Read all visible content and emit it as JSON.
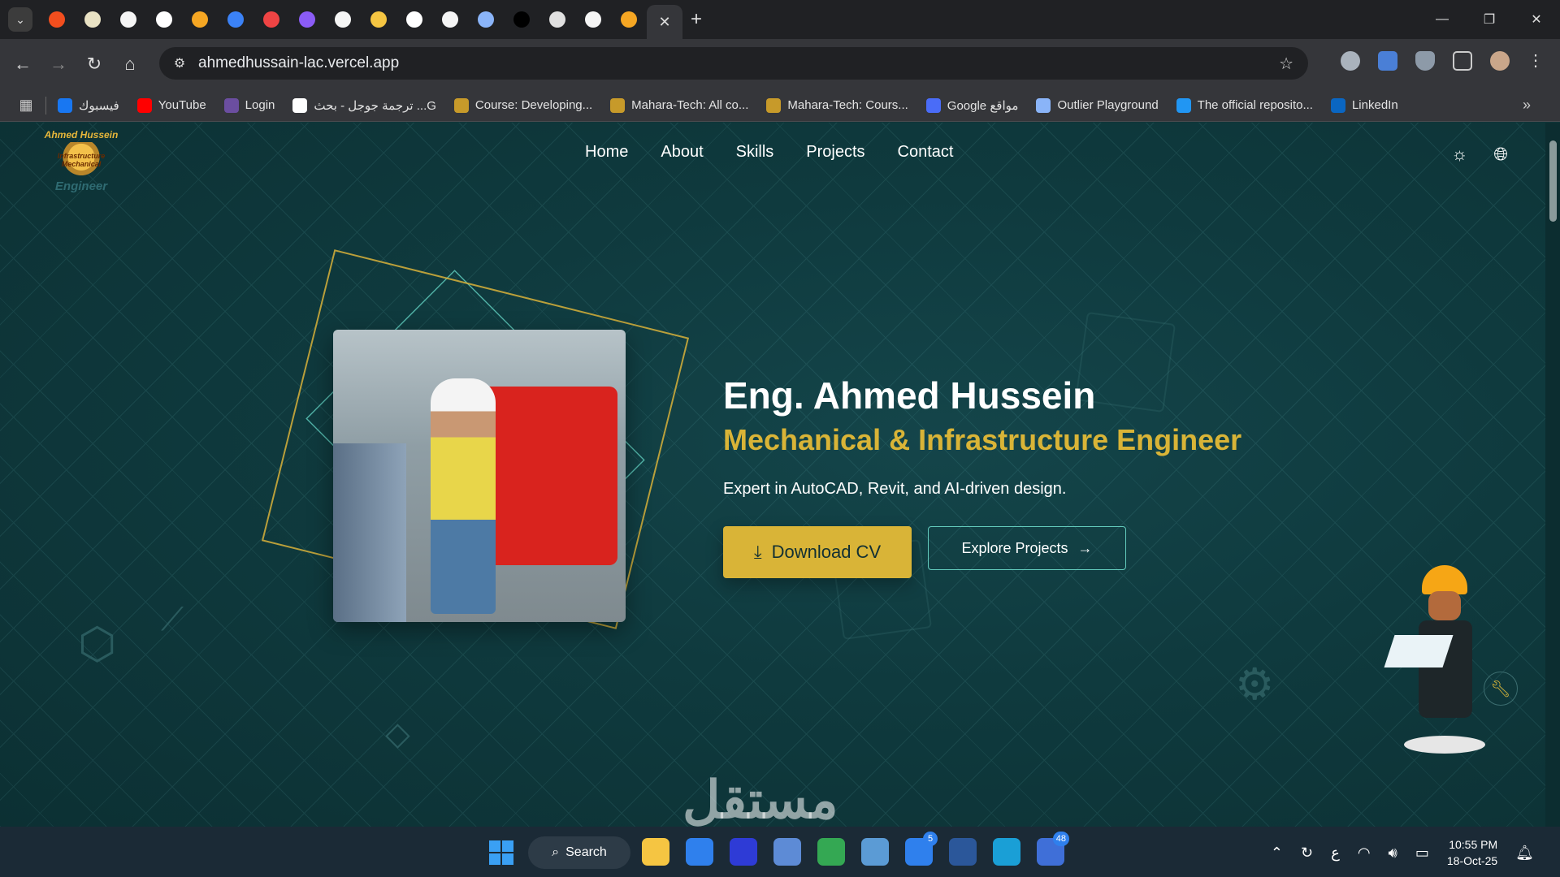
{
  "browser": {
    "tab_search_icon": "chevron-down-icon",
    "active_tab_close": "✕",
    "new_tab": "+",
    "window_controls": [
      "—",
      "❐",
      "✕"
    ],
    "url": "ahmedhussain-lac.vercel.app",
    "bookmarks": [
      {
        "label": "فيسبوك",
        "color": "#1877f2"
      },
      {
        "label": "YouTube",
        "color": "#ff0000"
      },
      {
        "label": "Login",
        "color": "#6b4ea0"
      },
      {
        "label": "ترجمة جوجل - بحث ...G",
        "color": "#ffffff"
      },
      {
        "label": "Course: Developing...",
        "color": "#c79a2a"
      },
      {
        "label": "Mahara-Tech: All co...",
        "color": "#c79a2a"
      },
      {
        "label": "Mahara-Tech: Cours...",
        "color": "#c79a2a"
      },
      {
        "label": "Google مواقع",
        "color": "#4a6cf7"
      },
      {
        "label": "Outlier Playground",
        "color": "#8ab4f8"
      },
      {
        "label": "The official reposito...",
        "color": "#2196f3"
      },
      {
        "label": "LinkedIn",
        "color": "#0a66c2"
      }
    ],
    "more_bookmarks": "»",
    "tab_colors": [
      "#f24e1e",
      "#e9e2c4",
      "#f5f5f5",
      "#ffffff",
      "#f5a623",
      "#3b82f6",
      "#ef4444",
      "#8b5cf6",
      "#f5f5f5",
      "#f5c542",
      "#ffffff",
      "#f5f5f5",
      "#8ab4f8",
      "#000000",
      "#e0e0e0",
      "#f5f5f5",
      "#f5a623"
    ]
  },
  "site": {
    "logo": {
      "top": "Ahmed Hussein",
      "mid": "Infrastructure Mechanical",
      "bottom": "Engineer"
    },
    "nav": [
      "Home",
      "About",
      "Skills",
      "Projects",
      "Contact"
    ],
    "theme_icon": "sun-icon",
    "language_icon": "globe-icon",
    "hero": {
      "name": "Eng. Ahmed Hussein",
      "role": "Mechanical & Infrastructure Engineer",
      "description": "Expert in AutoCAD, Revit, and AI-driven design.",
      "cv_button": "Download CV",
      "explore_button": "Explore Projects"
    },
    "colors": {
      "accent": "#d9b437",
      "teal": "#63cbbd",
      "background": "#0f3538"
    }
  },
  "watermark": "مستقل",
  "taskbar": {
    "search_label": "Search",
    "apps": [
      {
        "name": "file-explorer",
        "color": "#f5c542"
      },
      {
        "name": "vscode",
        "color": "#2f80ed"
      },
      {
        "name": "visual-studio",
        "color": "#2e3bd6"
      },
      {
        "name": "app-4",
        "color": "#5d8bd6"
      },
      {
        "name": "chrome",
        "color": "#34a853"
      },
      {
        "name": "app-6",
        "color": "#5b9bd5"
      },
      {
        "name": "todo",
        "color": "#2f80ed",
        "badge": "5"
      },
      {
        "name": "word",
        "color": "#2b579a"
      },
      {
        "name": "edge",
        "color": "#1a9fd6"
      },
      {
        "name": "teams",
        "color": "#3f6fd8",
        "badge": "48"
      }
    ],
    "tray_lang": "ع",
    "time": "10:55 PM",
    "date": "18-Oct-25"
  }
}
